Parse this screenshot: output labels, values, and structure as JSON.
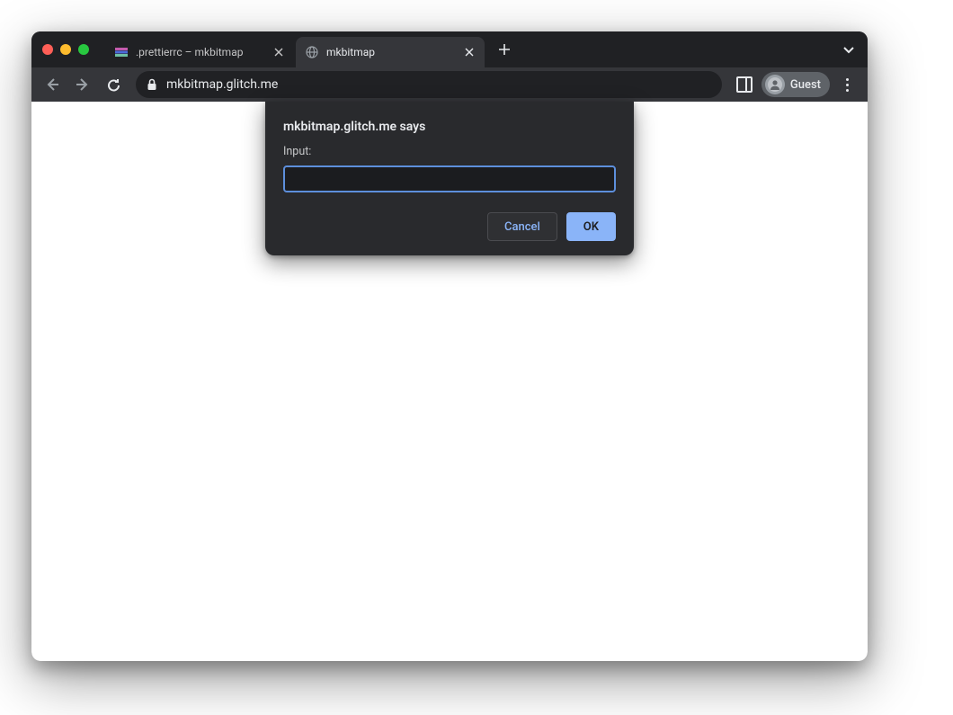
{
  "tabs": [
    {
      "title": ".prettierrc – mkbitmap",
      "active": false
    },
    {
      "title": "mkbitmap",
      "active": true
    }
  ],
  "toolbar": {
    "url": "mkbitmap.glitch.me",
    "profile_label": "Guest"
  },
  "dialog": {
    "title": "mkbitmap.glitch.me says",
    "label": "Input:",
    "input_value": "",
    "cancel_label": "Cancel",
    "ok_label": "OK"
  }
}
